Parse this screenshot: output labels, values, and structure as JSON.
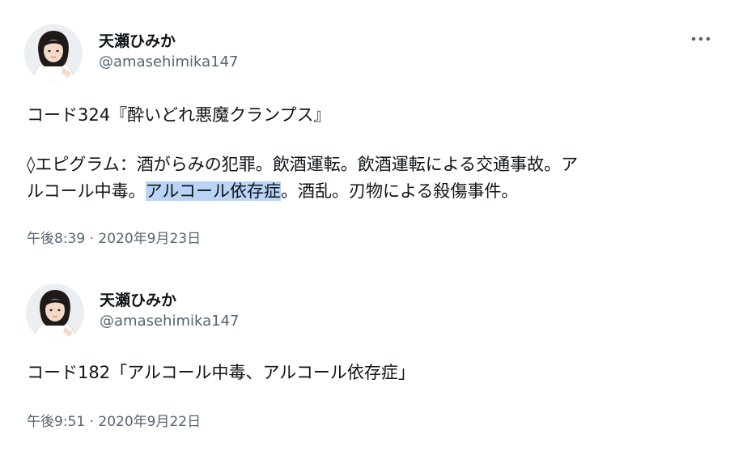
{
  "tweets": [
    {
      "author": {
        "display_name": "天瀬ひみか",
        "handle": "@amasehimika147"
      },
      "more_icon": "more-horizontal-icon",
      "body": {
        "line1": "コード324『酔いどれ悪魔クランプス』",
        "line2": "◊エピグラム：酒がらみの犯罪。飲酒運転。飲酒運転による交通事故。ア",
        "line3_before": "ルコール中毒。",
        "line3_highlight": "アルコール依存症",
        "line3_after": "。酒乱。刃物による殺傷事件。"
      },
      "timestamp": "午後8:39 · 2020年9月23日"
    },
    {
      "author": {
        "display_name": "天瀬ひみか",
        "handle": "@amasehimika147"
      },
      "body": {
        "line1": "コード182「アルコール中毒、アルコール依存症」"
      },
      "timestamp": "午後9:51 · 2020年9月22日"
    }
  ],
  "colors": {
    "text": "#0f1419",
    "secondary": "#536471",
    "selection": "#b9d4f7",
    "background": "#ffffff"
  }
}
